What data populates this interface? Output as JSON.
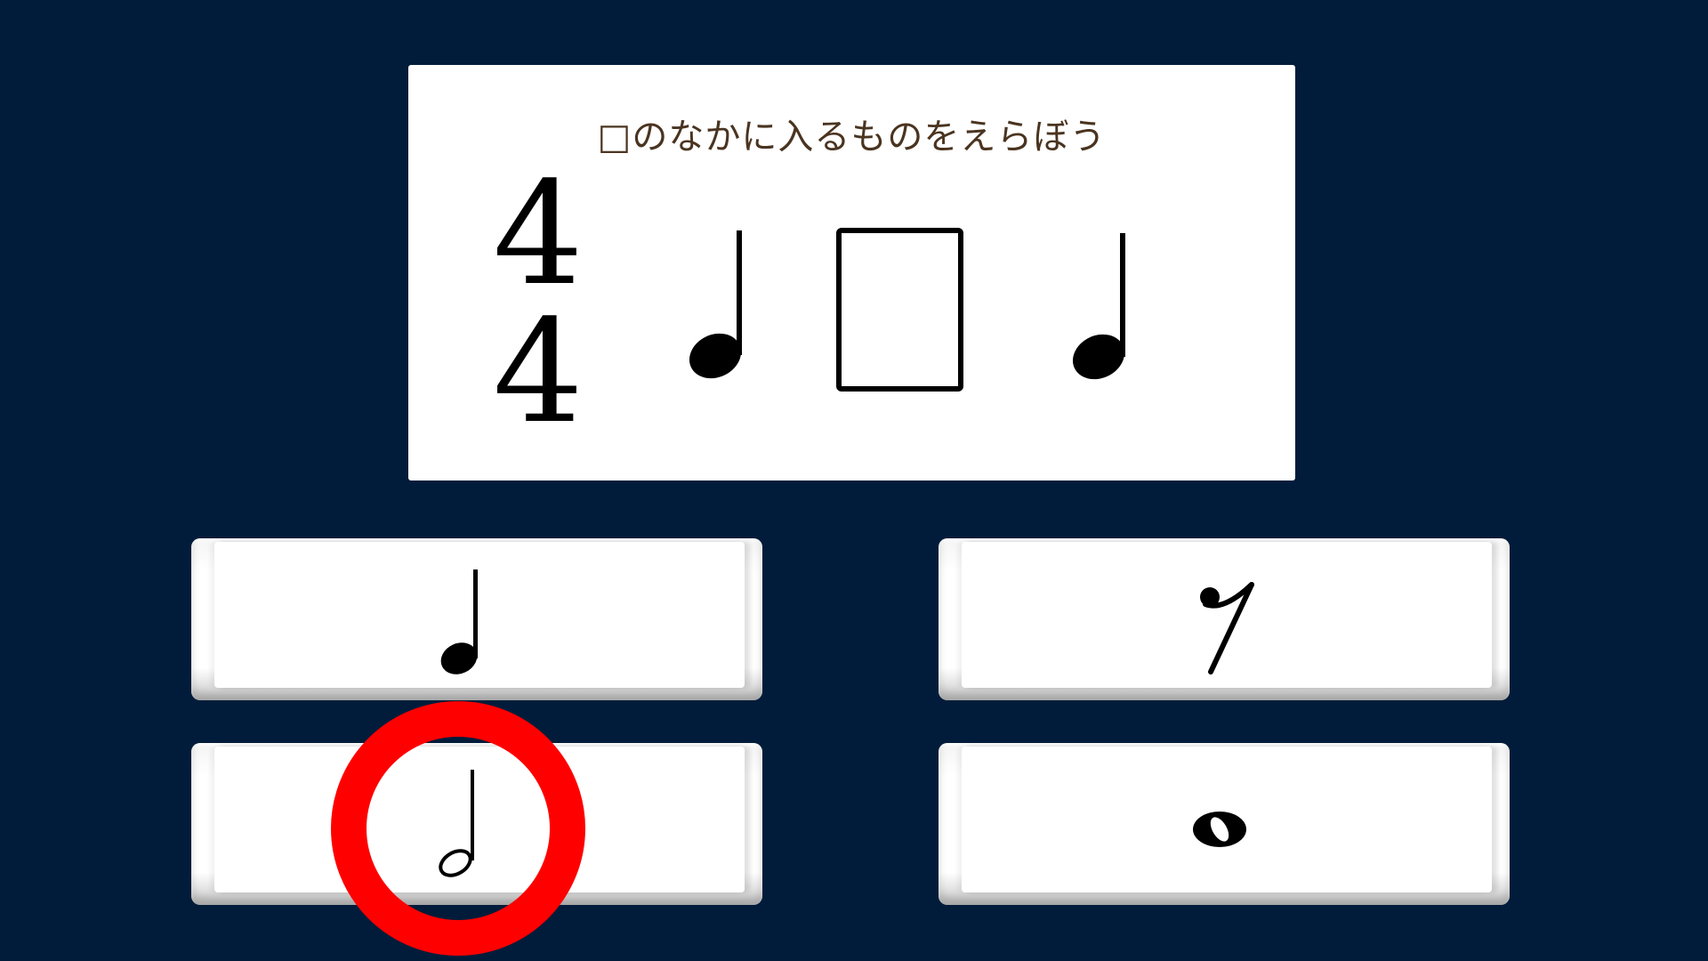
{
  "question": {
    "prompt": "□のなかに入るものをえらぼう",
    "time_signature": {
      "top": "4",
      "bottom": "4"
    },
    "sequence": [
      "quarter-note-icon",
      "blank-box",
      "quarter-note-icon"
    ]
  },
  "answers": [
    {
      "icon": "quarter-note-icon",
      "selected": false,
      "correct": false
    },
    {
      "icon": "eighth-rest-icon",
      "selected": false,
      "correct": false
    },
    {
      "icon": "half-note-icon",
      "selected": true,
      "correct": true
    },
    {
      "icon": "whole-note-icon",
      "selected": false,
      "correct": false
    }
  ],
  "feedback": {
    "icon": "correct-circle-icon",
    "color": "#ff0000"
  },
  "colors": {
    "background": "#011c3a",
    "card": "#ffffff",
    "prompt_text": "#4a3420",
    "feedback": "#ff0000"
  }
}
